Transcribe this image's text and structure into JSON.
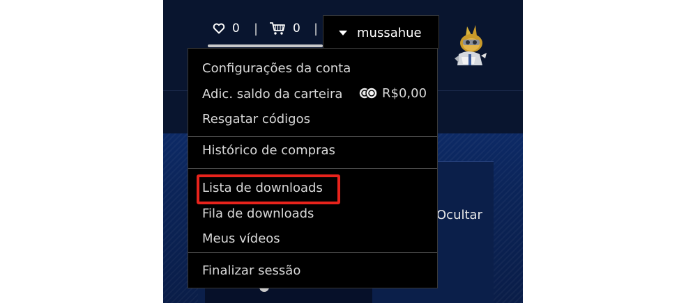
{
  "header": {
    "wishlist": {
      "icon": "heart-icon",
      "count": "0"
    },
    "cart": {
      "icon": "cart-icon",
      "count": "0"
    },
    "separator": "|",
    "user": {
      "name": "mussahue",
      "icon": "caret-down-icon"
    }
  },
  "background": {
    "hide_label": "Ocultar"
  },
  "menu": {
    "items": [
      {
        "label": "Configurações da conta"
      },
      {
        "label": "Adic. saldo da carteira",
        "balance": "R$0,00"
      },
      {
        "label": "Resgatar códigos"
      },
      {
        "label": "Histórico de compras"
      },
      {
        "label": "Lista de downloads",
        "highlighted": true
      },
      {
        "label": "Fila de downloads"
      },
      {
        "label": "Meus vídeos"
      },
      {
        "label": "Finalizar sessão"
      }
    ]
  },
  "colors": {
    "highlight": "#e8231c",
    "menu_bg": "#000000",
    "page_bg": "#09152f"
  }
}
